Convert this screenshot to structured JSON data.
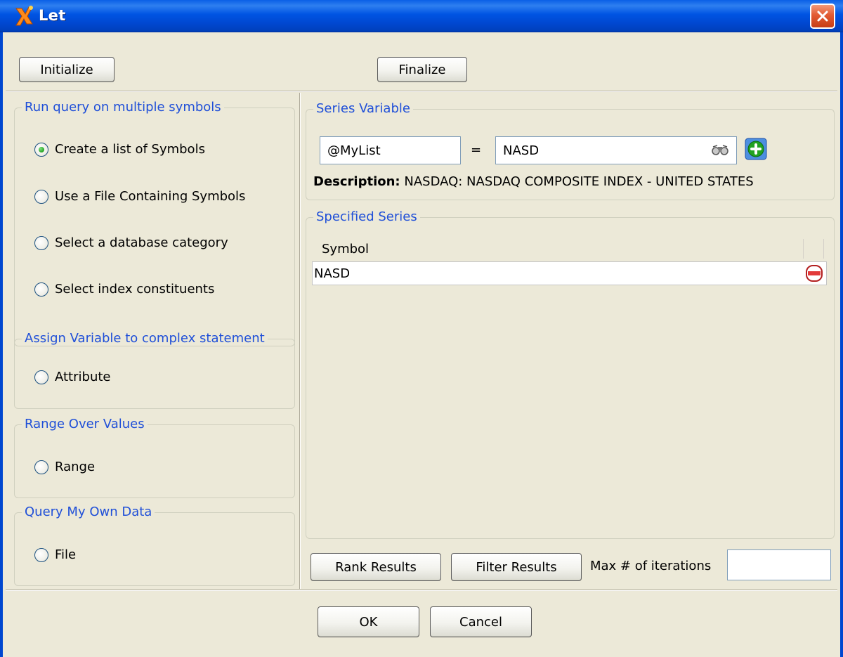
{
  "window": {
    "title": "Let",
    "close_label": "×"
  },
  "toolbar": {
    "initialize_label": "Initialize",
    "finalize_label": "Finalize"
  },
  "query_group": {
    "title": "Run query on multiple symbols",
    "options": [
      {
        "label": "Create a list of Symbols",
        "checked": true
      },
      {
        "label": "Use a File Containing Symbols",
        "checked": false
      },
      {
        "label": "Select a database category",
        "checked": false
      },
      {
        "label": "Select index constituents",
        "checked": false
      }
    ]
  },
  "assign_group": {
    "title": "Assign Variable to complex statement",
    "option": "Attribute"
  },
  "range_group": {
    "title": "Range Over Values",
    "option": "Range"
  },
  "own_data_group": {
    "title": "Query My Own Data",
    "option": "File"
  },
  "series_variable": {
    "title": "Series Variable",
    "variable_value": "@MyList",
    "equals": "=",
    "symbol_value": "NASD",
    "description_label": "Description:",
    "description_value": "NASDAQ: NASDAQ COMPOSITE INDEX  - UNITED STATES"
  },
  "specified_series": {
    "title": "Specified Series",
    "column_header": "Symbol",
    "rows": [
      {
        "symbol": "NASD"
      }
    ]
  },
  "bottom_controls": {
    "rank_label": "Rank Results",
    "filter_label": "Filter Results",
    "max_iterations_label": "Max # of iterations",
    "max_iterations_value": ""
  },
  "footer": {
    "ok_label": "OK",
    "cancel_label": "Cancel"
  },
  "colors": {
    "title_bar": "#0054e3",
    "group_title": "#1f4fd8",
    "dialog_bg": "#ece9d8",
    "close_button": "#e25b33"
  },
  "icons": [
    "app-x-icon",
    "close-icon",
    "binoculars-icon",
    "add-icon",
    "remove-icon"
  ]
}
